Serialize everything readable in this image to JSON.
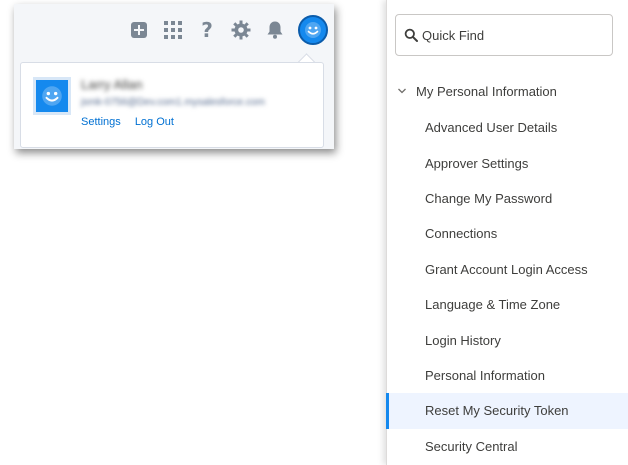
{
  "header": {
    "icons": [
      "add-icon",
      "app-launcher-icon",
      "help-icon",
      "setup-gear-icon",
      "notifications-bell-icon",
      "avatar-icon"
    ],
    "help_glyph": "?"
  },
  "profile": {
    "name": "Larry Allan",
    "email": "jsmk-0756@Dev.com1.mysalesforce.com",
    "links": {
      "settings": "Settings",
      "logout": "Log Out"
    }
  },
  "setup": {
    "quick_find": {
      "placeholder": "Quick Find",
      "value": ""
    },
    "section": {
      "label": "My Personal Information",
      "expanded": true
    },
    "items": [
      {
        "label": "Advanced User Details"
      },
      {
        "label": "Approver Settings"
      },
      {
        "label": "Change My Password"
      },
      {
        "label": "Connections"
      },
      {
        "label": "Grant Account Login Access"
      },
      {
        "label": "Language & Time Zone"
      },
      {
        "label": "Login History"
      },
      {
        "label": "Personal Information"
      },
      {
        "label": "Reset My Security Token",
        "selected": true
      },
      {
        "label": "Security Central"
      }
    ]
  },
  "colors": {
    "brand": "#1589ee",
    "link": "#0070d2",
    "icon_gray": "#7b8794",
    "selected_bg": "#eef4ff"
  }
}
